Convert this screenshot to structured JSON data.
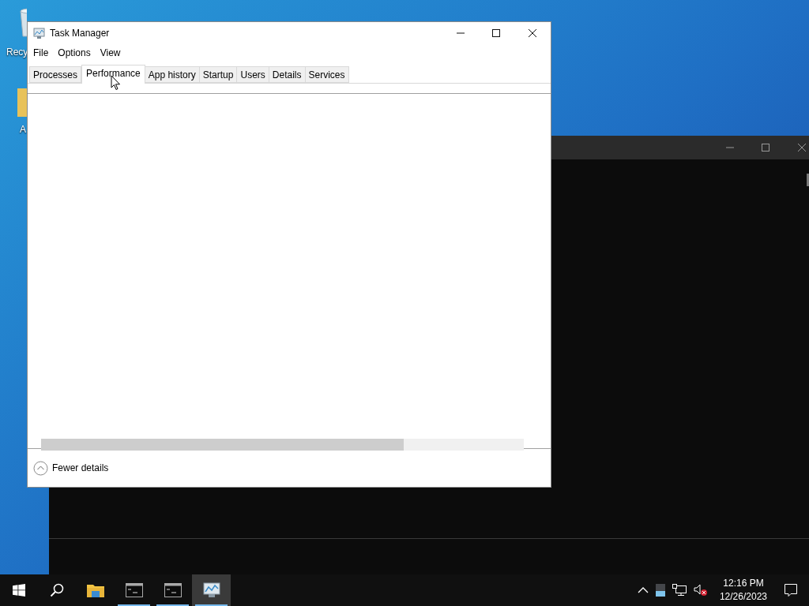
{
  "desktop_icons": [
    {
      "label": "Recy"
    },
    {
      "label": "A"
    }
  ],
  "background_window": {
    "kind": "console"
  },
  "window": {
    "title": "Task Manager"
  },
  "menu": [
    "File",
    "Options",
    "View"
  ],
  "tabs": [
    {
      "label": "Processes",
      "selected": false
    },
    {
      "label": "Performance",
      "selected": true
    },
    {
      "label": "App history",
      "selected": false
    },
    {
      "label": "Startup",
      "selected": false
    },
    {
      "label": "Users",
      "selected": false
    },
    {
      "label": "Details",
      "selected": false
    },
    {
      "label": "Services",
      "selected": false
    }
  ],
  "footer": {
    "label": "Fewer details"
  },
  "taskbar": {
    "apps": [
      {
        "kind": "explorer",
        "running": false,
        "selected": false
      },
      {
        "kind": "console",
        "running": true,
        "selected": false
      },
      {
        "kind": "console",
        "running": true,
        "selected": false
      },
      {
        "kind": "taskmanager",
        "running": true,
        "selected": true
      }
    ],
    "time": "12:16 PM",
    "date": "12/26/2023"
  }
}
